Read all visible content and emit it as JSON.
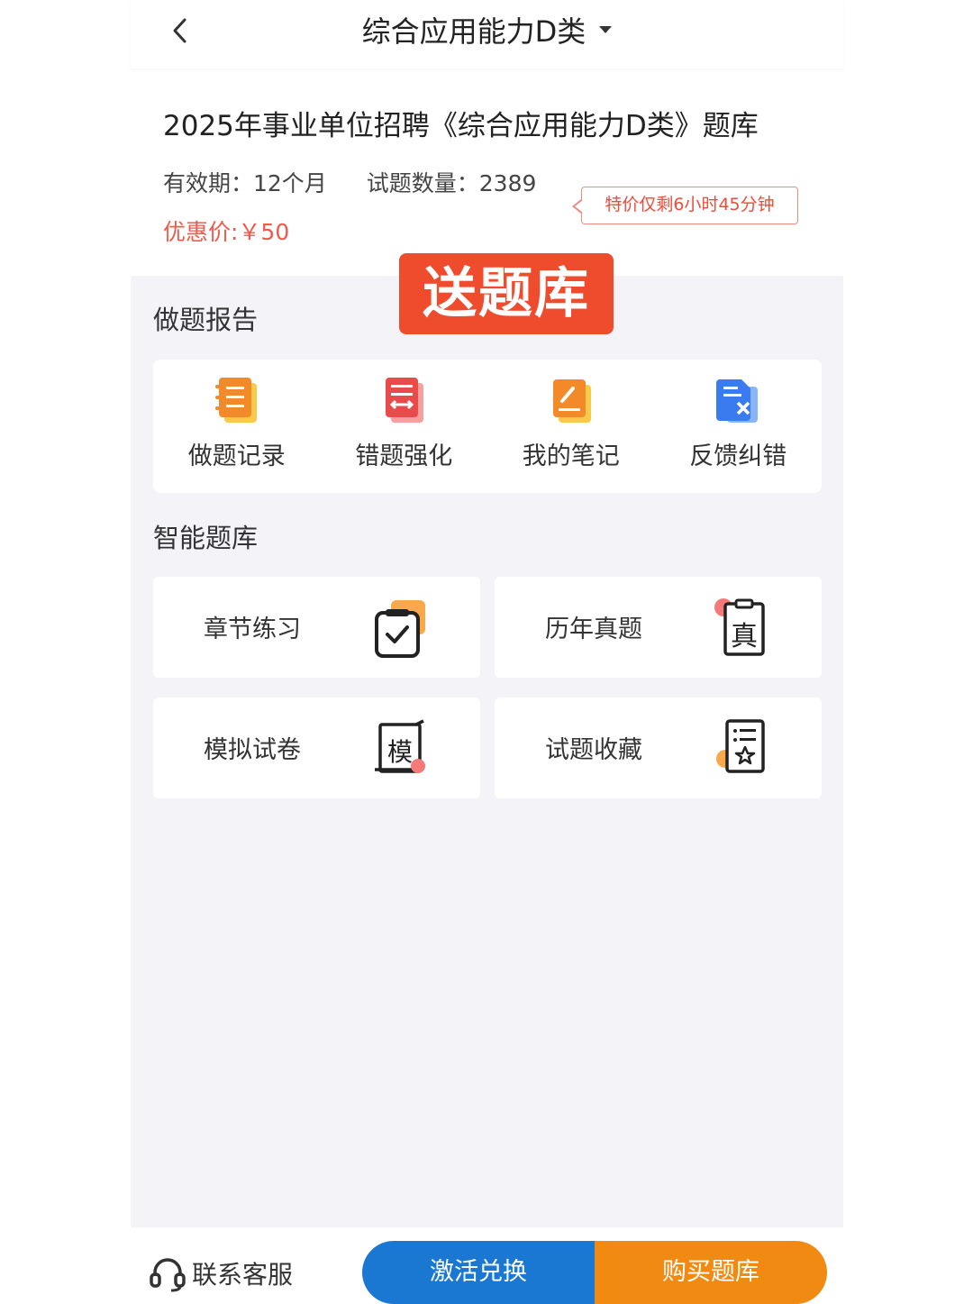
{
  "header": {
    "title": "综合应用能力D类",
    "back_icon": "chevron-left-icon",
    "dropdown_icon": "caret-down-icon"
  },
  "info": {
    "bank_title": "2025年事业单位招聘《综合应用能力D类》题库",
    "validity": "有效期：12个月",
    "question_count": "试题数量：2389",
    "price": "优惠价:￥50",
    "countdown": "特价仅剩6小时45分钟"
  },
  "promo_label": "送题库",
  "report": {
    "title": "做题报告",
    "items": [
      {
        "label": "做题记录",
        "icon": "record-icon"
      },
      {
        "label": "错题强化",
        "icon": "wrong-questions-icon"
      },
      {
        "label": "我的笔记",
        "icon": "notes-icon"
      },
      {
        "label": "反馈纠错",
        "icon": "feedback-icon"
      }
    ]
  },
  "bank": {
    "title": "智能题库",
    "items": [
      {
        "label": "章节练习",
        "icon": "chapter-practice-icon"
      },
      {
        "label": "历年真题",
        "icon": "past-papers-icon"
      },
      {
        "label": "模拟试卷",
        "icon": "mock-exam-icon"
      },
      {
        "label": "试题收藏",
        "icon": "favorites-icon"
      }
    ]
  },
  "bottom": {
    "service_label": "联系客服",
    "activate_label": "激活兑换",
    "buy_label": "购买题库"
  },
  "colors": {
    "accent_red": "#ef4b2d",
    "price_red": "#f05a4a",
    "blue": "#1a78d3",
    "orange": "#f18a12",
    "background": "#f3f3f8"
  }
}
